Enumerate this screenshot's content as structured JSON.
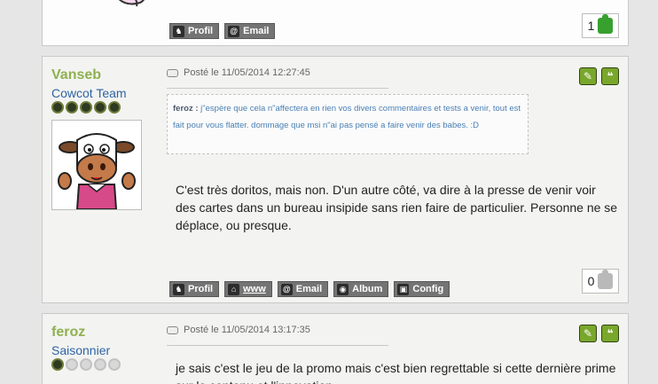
{
  "post_top": {
    "toolbar": [
      {
        "label": "Profil",
        "icon": "cow-icon"
      },
      {
        "label": "Email",
        "icon": "at-icon"
      }
    ],
    "likes": "1"
  },
  "post_vanseb": {
    "author": "Vanseb",
    "rank": "Cowcot Team",
    "cow_rating": [
      1,
      1,
      1,
      1,
      1
    ],
    "meta": "Posté le 11/05/2014 12:27:45",
    "quote": {
      "author": "feroz :",
      "text": "j\"espère que cela n\"affectera en rien vos divers commentaires et tests a venir, tout est fait pour vous flatter. dommage que msi n\"ai pas pensé a faire venir des babes. :D"
    },
    "body": "C'est très doritos, mais non. D'un autre côté, va dire à la presse de venir voir des cartes dans un bureau insipide sans rien faire de particulier. Personne ne se déplace, ou presque.",
    "toolbar": [
      {
        "label": "Profil",
        "icon": "cow-icon"
      },
      {
        "label": "www",
        "icon": "home-icon"
      },
      {
        "label": "Email",
        "icon": "at-icon"
      },
      {
        "label": "Album",
        "icon": "camera-icon"
      },
      {
        "label": "Config",
        "icon": "config-icon"
      }
    ],
    "likes": "0"
  },
  "post_feroz": {
    "author": "feroz",
    "rank": "Saisonnier",
    "cow_rating": [
      1,
      0,
      0,
      0,
      0
    ],
    "meta": "Posté le 11/05/2014 13:17:35",
    "body": "je sais c'est le jeu de la promo mais c'est bien regrettable si cette dernière prime sur le contenu et l'innovation..."
  },
  "colors": {
    "author_green": "#8fb050",
    "rank_blue": "#2f63a6",
    "quote_blue": "#4a80b4",
    "action_green": "#79a72c",
    "like_green": "#37a02e"
  }
}
